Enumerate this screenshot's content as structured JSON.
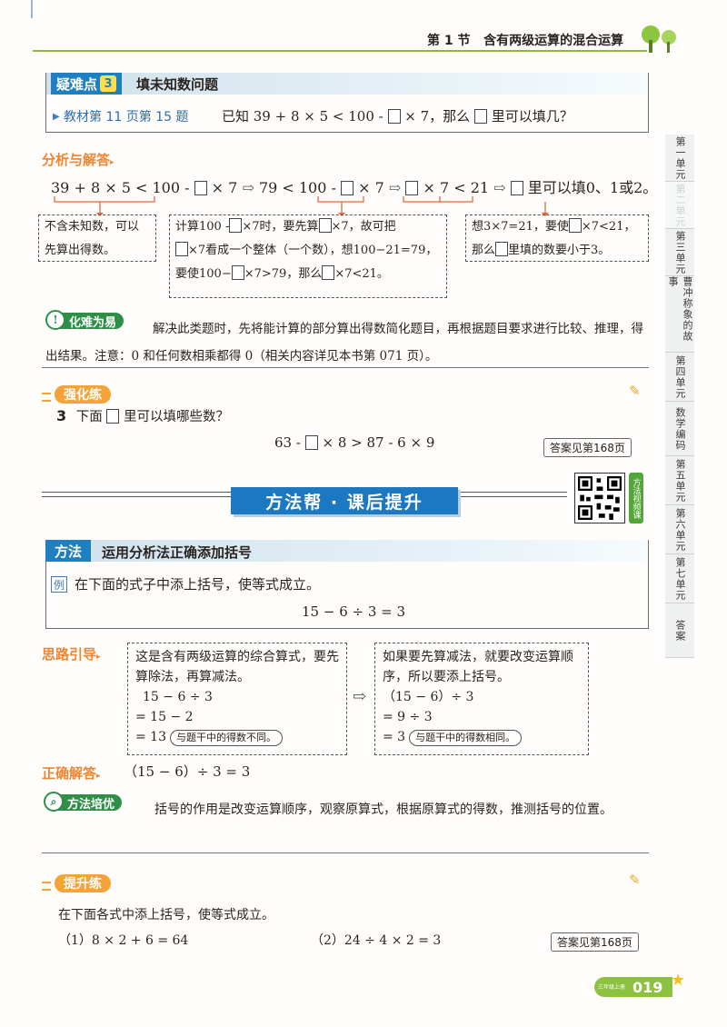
{
  "header": {
    "section": "第 1 节",
    "title": "含有两级运算的混合运算"
  },
  "side_tabs": [
    {
      "label": "第一单元",
      "active": false
    },
    {
      "label": "第二单元",
      "active": true
    },
    {
      "label": "第三单元",
      "active": false
    },
    {
      "label": "曹冲称象的故事",
      "active": false
    },
    {
      "label": "第四单元",
      "active": false
    },
    {
      "label": "数学编码",
      "active": false
    },
    {
      "label": "第五单元",
      "active": false
    },
    {
      "label": "第六单元",
      "active": false
    },
    {
      "label": "第七单元",
      "active": false
    },
    {
      "label": "答案",
      "active": false
    }
  ],
  "difficulty": {
    "tag": "疑难点",
    "number": "3",
    "title": "填未知数问题",
    "ref": "教材第 11 页第 15 题",
    "q_part1": "已知 39 + 8 × 5 < 100 -",
    "q_part2": "× 7，那么",
    "q_part3": "里可以填几？"
  },
  "analysis": {
    "label": "分析与解答",
    "step1": "39 + 8 × 5 < 100 -",
    "step1b": "× 7",
    "step2": "79 < 100 -",
    "step2b": "× 7",
    "step3b": "× 7 < 21",
    "step4b": "里可以填0、1或2。",
    "note1": "不含未知数，可以先算出得数。",
    "note2_a": "计算100 -",
    "note2_b": "×7时，要先算",
    "note2_c": "×7，故可把",
    "note2_d": "×7看成一个整体（一个数），想100−21=79，要使100−",
    "note2_e": "×7>79，那么",
    "note2_f": "×7<21。",
    "note3_a": "想3×7=21，要使",
    "note3_b": "×7<21，那么",
    "note3_c": "里填的数要小于3。"
  },
  "tip": {
    "tag": "化难为易",
    "text": "解决此类题时，先将能计算的部分算出得数简化题目，再根据题目要求进行比较、推理，得出结果。注意：0 和任何数相乘都得 0（相关内容详见本书第 071 页）。"
  },
  "strong_practice": {
    "tag": "强化练",
    "q_num": "3",
    "q_text_a": "下面",
    "q_text_b": "里可以填哪些数？",
    "eq_a": "63 -",
    "eq_b": "× 8 > 87 - 6 × 9",
    "answer_ref": "答案见第168页"
  },
  "banner": {
    "title": "方法帮 · 课后提升",
    "qr_label": "方法视频课"
  },
  "method": {
    "tag": "方法",
    "title": "运用分析法正确添加括号",
    "example_tag": "例",
    "example_text": "在下面的式子中添上括号，使等式成立。",
    "example_eq": "15 − 6 ÷ 3 = 3"
  },
  "idea": {
    "label": "思路引导",
    "left_text": "这是含有两级运算的综合算式，要先算除法，再算减法。",
    "left_l1": "15 − 6 ÷ 3",
    "left_l2": "= 15 − 2",
    "left_l3": "= 13",
    "left_bubble": "与题干中的得数不同。",
    "right_text": "如果要先算减法，就要改变运算顺序，所以要添上括号。",
    "right_l1": "（15 − 6）÷ 3",
    "right_l2": "= 9 ÷ 3",
    "right_l3": "= 3",
    "right_bubble": "与题干中的得数相同。"
  },
  "correct": {
    "label": "正确解答",
    "eq": "（15 − 6）÷ 3 = 3"
  },
  "method_tip": {
    "tag": "方法培优",
    "text": "括号的作用是改变运算顺序，观察原算式，根据原算式的得数，推测括号的位置。"
  },
  "lift_practice": {
    "tag": "提升练",
    "text": "在下面各式中添上括号，使等式成立。",
    "q1": "（1）8 × 2 + 6 = 64",
    "q2": "（2）24 ÷ 4 × 2 = 3",
    "answer_ref": "答案见第168页"
  },
  "footer": {
    "badge_small": "三年级上册",
    "page_num": "019"
  },
  "colors": {
    "accent_blue": "#1f7fbf",
    "accent_orange": "#f08530",
    "accent_green": "#2f8f48",
    "header_green": "#8ab93a"
  }
}
